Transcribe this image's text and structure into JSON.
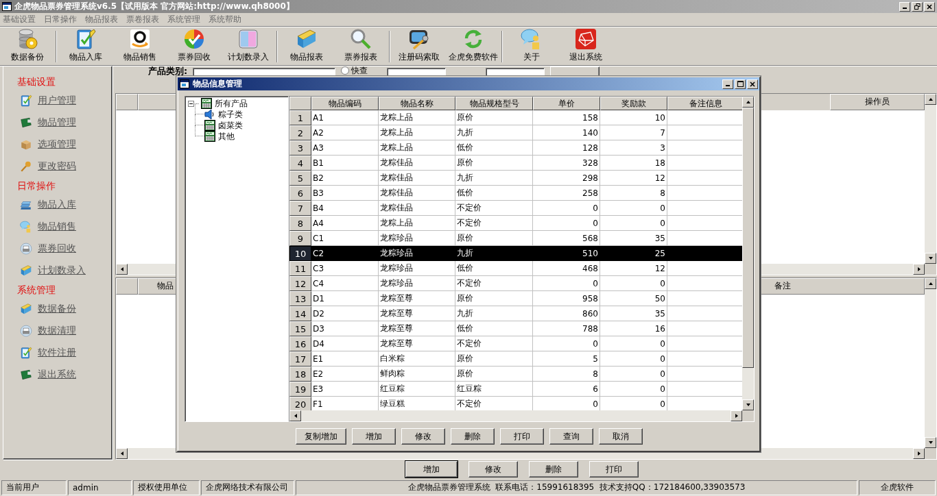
{
  "window": {
    "title": "企虎物品票券管理系统v6.5【试用版本 官方网站:http://www.qh8000】"
  },
  "menu": [
    "基础设置",
    "日常操作",
    "物品报表",
    "票卷报表",
    "系统管理",
    "系统帮助"
  ],
  "toolbar": {
    "groups": [
      {
        "buttons": [
          "数据备份"
        ]
      },
      {
        "buttons": [
          "物品入库",
          "物品销售",
          "票券回收",
          "计划数录入"
        ]
      },
      {
        "buttons": [
          "物品报表",
          "票券报表"
        ]
      },
      {
        "buttons": [
          "注册码索取",
          "企虎免费软件"
        ]
      },
      {
        "buttons": [
          "关于",
          "退出系统"
        ]
      }
    ]
  },
  "sidebar": {
    "sections": [
      {
        "title": "基础设置",
        "items": [
          "用户管理",
          "物品管理",
          "选项管理",
          "更改密码"
        ]
      },
      {
        "title": "日常操作",
        "items": [
          "物品入库",
          "物品销售",
          "票券回收",
          "计划数录入"
        ]
      },
      {
        "title": "系统管理",
        "items": [
          "数据备份",
          "数据清理",
          "软件注册",
          "退出系统"
        ]
      }
    ]
  },
  "filter": {
    "label": "产品类别:",
    "quick_search": {
      "label": "快查",
      "selected": false
    }
  },
  "upper_grid": {
    "columns": [
      "操作员"
    ]
  },
  "lower_grid": {
    "columns": [
      "物品",
      "备注"
    ]
  },
  "actions": [
    {
      "label": "增加",
      "default": true
    },
    {
      "label": "修改",
      "default": false
    },
    {
      "label": "删除",
      "default": false
    },
    {
      "label": "打印",
      "default": false
    }
  ],
  "status_bar": [
    "当前用户",
    "admin",
    "授权使用单位",
    "企虎网络技术有限公司",
    "企虎物品票券管理系统  联系电话：15991618395  技术支持QQ：172184600,33903573",
    "企虎软件"
  ],
  "dialog": {
    "title": "物品信息管理",
    "tree": {
      "label": "所有产品",
      "expanded": true,
      "children": [
        {
          "label": "粽子类"
        },
        {
          "label": "卤菜类"
        },
        {
          "label": "其他"
        }
      ]
    },
    "table": {
      "columns": [
        "物品编码",
        "物品名称",
        "物品规格型号",
        "单价",
        "奖励款",
        "备注信息"
      ],
      "rows": [
        {
          "number": "1",
          "cells": [
            "A1",
            "龙粽上品",
            "原价",
            "158",
            "10"
          ],
          "selected": false
        },
        {
          "number": "2",
          "cells": [
            "A2",
            "龙粽上品",
            "九折",
            "140",
            "7"
          ],
          "selected": false
        },
        {
          "number": "3",
          "cells": [
            "A3",
            "龙粽上品",
            "低价",
            "128",
            "3"
          ],
          "selected": false
        },
        {
          "number": "4",
          "cells": [
            "B1",
            "龙粽佳品",
            "原价",
            "328",
            "18"
          ],
          "selected": false
        },
        {
          "number": "5",
          "cells": [
            "B2",
            "龙粽佳品",
            "九折",
            "298",
            "12"
          ],
          "selected": false
        },
        {
          "number": "6",
          "cells": [
            "B3",
            "龙粽佳品",
            "低价",
            "258",
            "8"
          ],
          "selected": false
        },
        {
          "number": "7",
          "cells": [
            "B4",
            "龙粽佳品",
            "不定价",
            "0",
            "0"
          ],
          "selected": false
        },
        {
          "number": "8",
          "cells": [
            "A4",
            "龙粽上品",
            "不定价",
            "0",
            "0"
          ],
          "selected": false
        },
        {
          "number": "9",
          "cells": [
            "C1",
            "龙粽珍品",
            "原价",
            "568",
            "35"
          ],
          "selected": false
        },
        {
          "number": "10",
          "cells": [
            "C2",
            "龙粽珍品",
            "九折",
            "510",
            "25"
          ],
          "selected": true
        },
        {
          "number": "11",
          "cells": [
            "C3",
            "龙粽珍品",
            "低价",
            "468",
            "12"
          ],
          "selected": false
        },
        {
          "number": "12",
          "cells": [
            "C4",
            "龙粽珍品",
            "不定价",
            "0",
            "0"
          ],
          "selected": false
        },
        {
          "number": "13",
          "cells": [
            "D1",
            "龙粽至尊",
            "原价",
            "958",
            "50"
          ],
          "selected": false
        },
        {
          "number": "14",
          "cells": [
            "D2",
            "龙粽至尊",
            "九折",
            "860",
            "35"
          ],
          "selected": false
        },
        {
          "number": "15",
          "cells": [
            "D3",
            "龙粽至尊",
            "低价",
            "788",
            "16"
          ],
          "selected": false
        },
        {
          "number": "16",
          "cells": [
            "D4",
            "龙粽至尊",
            "不定价",
            "0",
            "0"
          ],
          "selected": false
        },
        {
          "number": "17",
          "cells": [
            "E1",
            "白米粽",
            "原价",
            "5",
            "0"
          ],
          "selected": false
        },
        {
          "number": "18",
          "cells": [
            "E2",
            "鲜肉粽",
            "原价",
            "8",
            "0"
          ],
          "selected": false
        },
        {
          "number": "19",
          "cells": [
            "E3",
            "红豆粽",
            "红豆粽",
            "6",
            "0"
          ],
          "selected": false
        },
        {
          "number": "20",
          "cells": [
            "F1",
            "绿豆糕",
            "不定价",
            "0",
            "0"
          ],
          "selected": false
        }
      ]
    },
    "buttons": [
      "复制增加",
      "增加",
      "修改",
      "删除",
      "打印",
      "查询",
      "取消"
    ]
  }
}
